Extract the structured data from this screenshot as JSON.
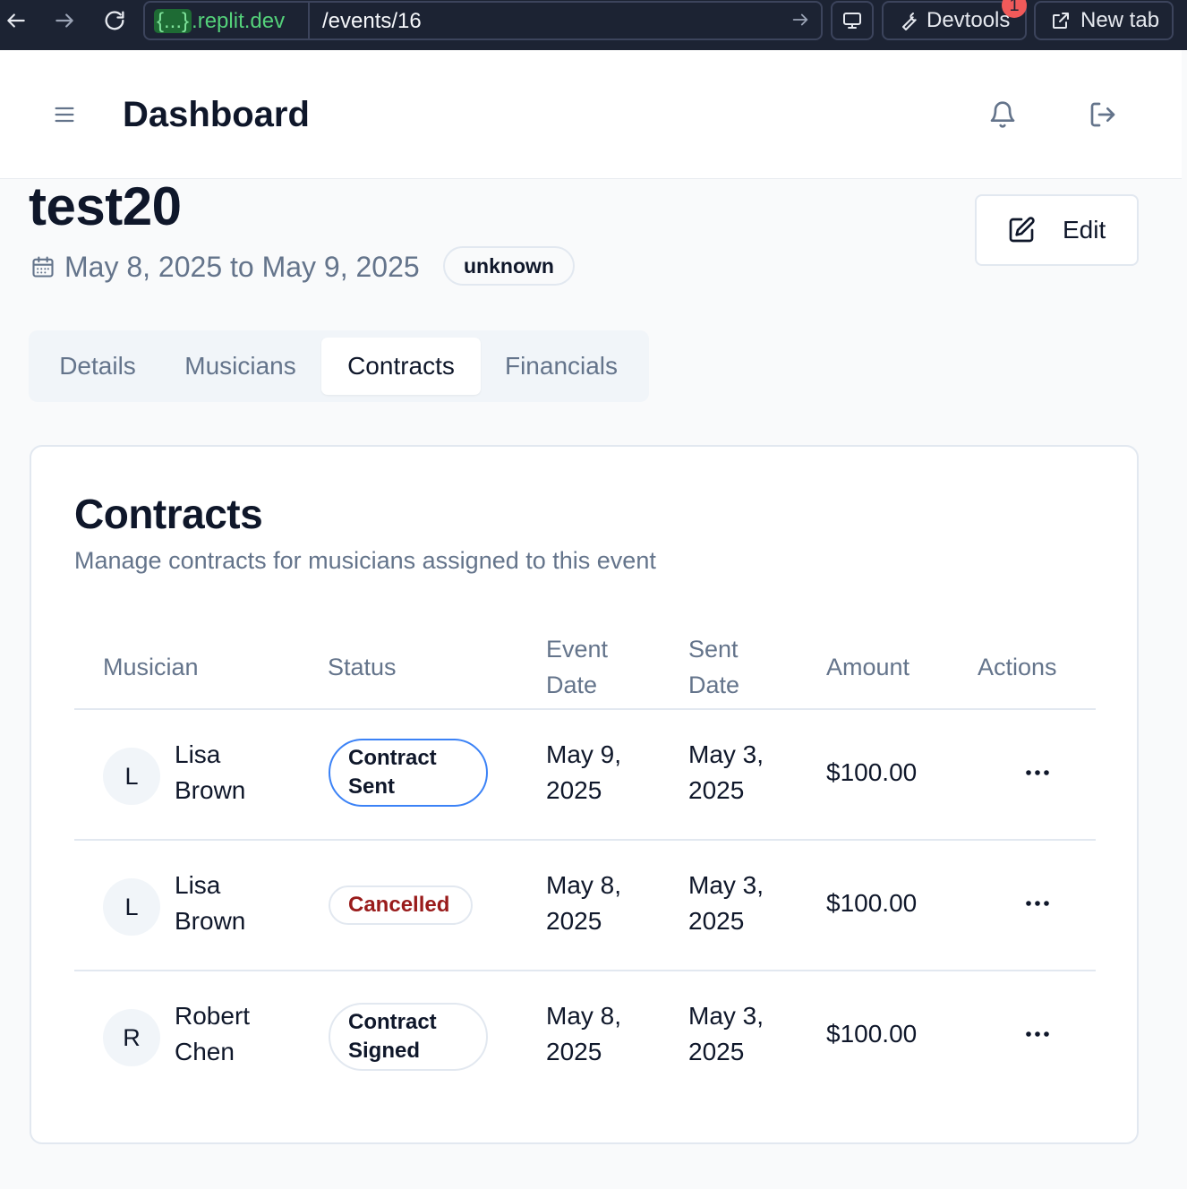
{
  "browser": {
    "url_domain_prefix": "{...}",
    "url_domain_suffix": ".replit.dev",
    "url_path": "/events/16",
    "devtools_label": "Devtools",
    "devtools_badge": "1",
    "newtab_label": "New tab"
  },
  "header": {
    "title": "Dashboard"
  },
  "event": {
    "name": "test20",
    "dates": "May 8, 2025 to May 9, 2025",
    "status": "unknown",
    "edit_label": "Edit"
  },
  "tabs": [
    {
      "label": "Details",
      "active": false
    },
    {
      "label": "Musicians",
      "active": false
    },
    {
      "label": "Contracts",
      "active": true
    },
    {
      "label": "Financials",
      "active": false
    }
  ],
  "contracts": {
    "title": "Contracts",
    "subtitle": "Manage contracts for musicians assigned to this event",
    "columns": {
      "musician": "Musician",
      "status": "Status",
      "event_date_1": "Event",
      "event_date_2": "Date",
      "sent_date_1": "Sent",
      "sent_date_2": "Date",
      "amount": "Amount",
      "actions": "Actions"
    },
    "rows": [
      {
        "initial": "L",
        "first": "Lisa",
        "last": "Brown",
        "status_1": "Contract",
        "status_2": "Sent",
        "event_date_1": "May 9,",
        "event_date_2": "2025",
        "sent_date_1": "May 3,",
        "sent_date_2": "2025",
        "amount": "$100.00"
      },
      {
        "initial": "L",
        "first": "Lisa",
        "last": "Brown",
        "status_1": "Cancelled",
        "status_2": "",
        "event_date_1": "May 8,",
        "event_date_2": "2025",
        "sent_date_1": "May 3,",
        "sent_date_2": "2025",
        "amount": "$100.00"
      },
      {
        "initial": "R",
        "first": "Robert",
        "last": "Chen",
        "status_1": "Contract",
        "status_2": "Signed",
        "event_date_1": "May 8,",
        "event_date_2": "2025",
        "sent_date_1": "May 3,",
        "sent_date_2": "2025",
        "amount": "$100.00"
      }
    ]
  },
  "colors": {
    "browser_bar": "#1c2333",
    "primary_text": "#0f172a",
    "muted_text": "#64748b",
    "sent_border": "#3b82f6",
    "cancelled_text": "#991b1b"
  },
  "icons": [
    "back-arrow-icon",
    "forward-arrow-icon",
    "reload-icon",
    "go-arrow-icon",
    "monitor-icon",
    "wrench-icon",
    "external-link-icon",
    "menu-icon",
    "bell-icon",
    "logout-icon",
    "calendar-icon",
    "edit-icon",
    "more-options-icon"
  ]
}
